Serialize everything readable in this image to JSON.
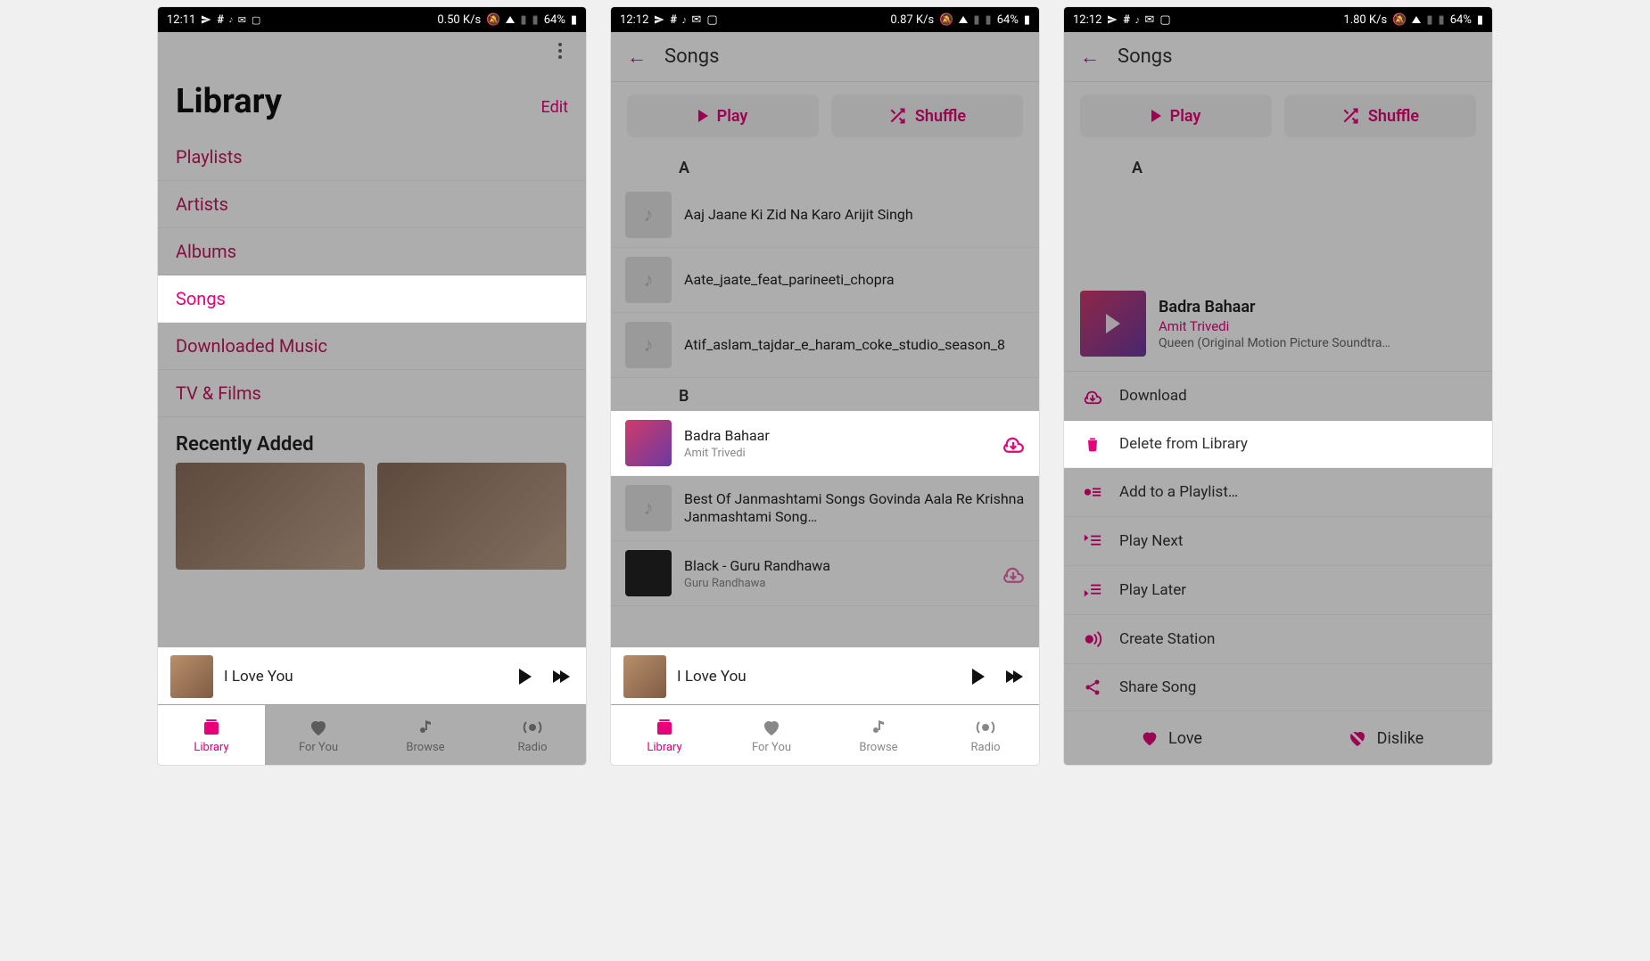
{
  "accent": "#e6007a",
  "screens": {
    "library": {
      "statusbar": {
        "time": "12:11",
        "net_rate": "0.50 K/s",
        "battery": "64%"
      },
      "title": "Library",
      "edit_label": "Edit",
      "sections": [
        "Playlists",
        "Artists",
        "Albums",
        "Songs",
        "Downloaded Music",
        "TV & Films"
      ],
      "highlight_index": 3,
      "recent_title": "Recently Added",
      "miniplayer": {
        "title": "I Love You"
      },
      "tabs": [
        "Library",
        "For You",
        "Browse",
        "Radio"
      ],
      "active_tab": 0
    },
    "songs": {
      "statusbar": {
        "time": "12:12",
        "net_rate": "0.87 K/s",
        "battery": "64%"
      },
      "title": "Songs",
      "play_label": "Play",
      "shuffle_label": "Shuffle",
      "letters": {
        "A": [
          {
            "title": "Aaj Jaane Ki Zid Na Karo Arijit Singh",
            "artist": "",
            "art": "placeholder"
          },
          {
            "title": "Aate_jaate_feat_parineeti_chopra",
            "artist": "",
            "art": "placeholder"
          },
          {
            "title": "Atif_aslam_tajdar_e_haram_coke_studio_season_8",
            "artist": "",
            "art": "placeholder"
          }
        ],
        "B": [
          {
            "title": "Badra Bahaar",
            "artist": "Amit Trivedi",
            "art": "colored",
            "download": true,
            "highlight": true
          },
          {
            "title": "Best Of Janmashtami Songs  Govinda Aala Re  Krishna Janmashtami Song…",
            "artist": "",
            "art": "placeholder"
          },
          {
            "title": "Black - Guru Randhawa",
            "artist": "Guru Randhawa",
            "art": "dark",
            "download": true
          }
        ]
      },
      "miniplayer": {
        "title": "I Love You"
      },
      "tabs": [
        "Library",
        "For You",
        "Browse",
        "Radio"
      ],
      "active_tab": 0
    },
    "context": {
      "statusbar": {
        "time": "12:12",
        "net_rate": "1.80 K/s",
        "battery": "64%"
      },
      "bg_title": "Songs",
      "bg_play_label": "Play",
      "bg_shuffle_label": "Shuffle",
      "bg_letter": "A",
      "header": {
        "title": "Badra Bahaar",
        "artist": "Amit Trivedi",
        "album": "Queen (Original Motion Picture Soundtra…"
      },
      "items": [
        {
          "icon": "download",
          "label": "Download"
        },
        {
          "icon": "trash",
          "label": "Delete from Library",
          "highlight": true
        },
        {
          "icon": "playlist-add",
          "label": "Add to a Playlist…"
        },
        {
          "icon": "play-next",
          "label": "Play Next"
        },
        {
          "icon": "play-later",
          "label": "Play Later"
        },
        {
          "icon": "station",
          "label": "Create Station"
        },
        {
          "icon": "share",
          "label": "Share Song"
        }
      ],
      "love_label": "Love",
      "dislike_label": "Dislike"
    }
  }
}
